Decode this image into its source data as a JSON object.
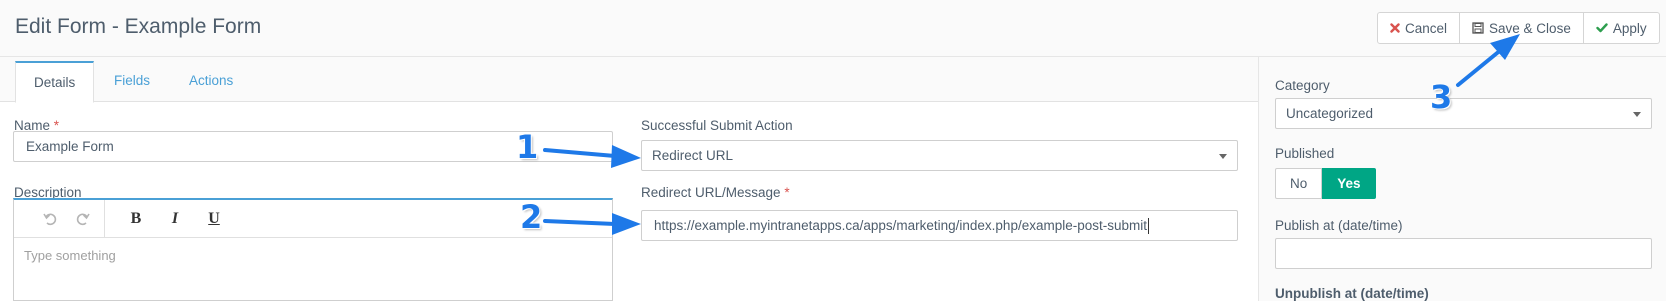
{
  "header": {
    "title": "Edit Form - Example Form",
    "buttons": {
      "cancel": "Cancel",
      "save_close": "Save & Close",
      "apply": "Apply"
    }
  },
  "tabs": [
    {
      "label": "Details",
      "active": true
    },
    {
      "label": "Fields",
      "active": false
    },
    {
      "label": "Actions",
      "active": false
    }
  ],
  "form": {
    "name_label": "Name",
    "name_value": "Example Form",
    "description_label": "Description",
    "description_placeholder": "Type something",
    "submit_action_label": "Successful Submit Action",
    "submit_action_value": "Redirect URL",
    "redirect_label": "Redirect URL/Message",
    "redirect_value": "https://example.myintranetapps.ca/apps/marketing/index.php/example-post-submit",
    "required_marker": "*"
  },
  "editor_tools": [
    {
      "name": "undo-icon"
    },
    {
      "name": "redo-icon"
    },
    {
      "name": "bold-button",
      "label": "B"
    },
    {
      "name": "italic-button",
      "label": "I"
    },
    {
      "name": "underline-button",
      "label": "U"
    }
  ],
  "sidebar": {
    "category_label": "Category",
    "category_value": "Uncategorized",
    "published_label": "Published",
    "published_no": "No",
    "published_yes": "Yes",
    "published_state": "Yes",
    "publish_at_label": "Publish at (date/time)",
    "publish_at_value": "",
    "unpublish_at_label": "Unpublish at (date/time)"
  },
  "annotations": [
    "1",
    "2",
    "3"
  ],
  "colors": {
    "accent_blue": "#4aa0d6",
    "yes_green": "#00a685",
    "annotation_blue": "#1e79e8",
    "required_red": "#d9534f",
    "cancel_red": "#d9534f",
    "apply_green": "#2e9e4f"
  }
}
